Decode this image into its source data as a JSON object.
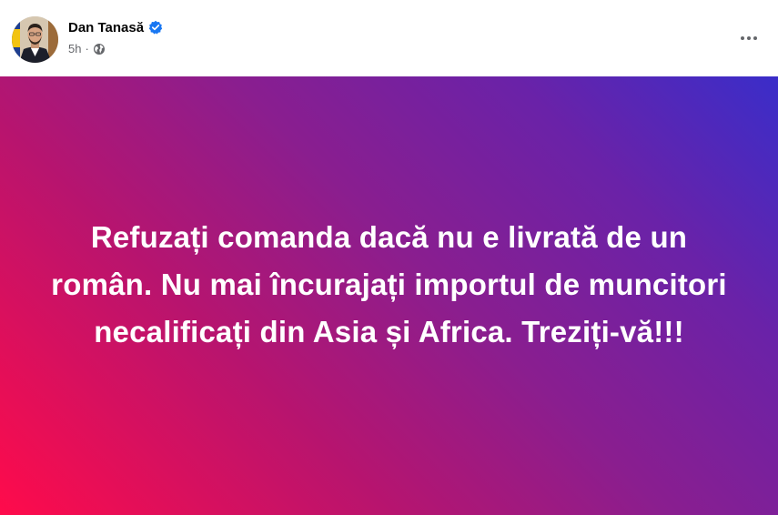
{
  "post": {
    "author_name": "Dan Tanasă",
    "time": "5h",
    "separator": "·",
    "audience_icon": "globe-icon",
    "verified_icon": "verified-badge-icon",
    "more_icon": "more-options-icon",
    "card_text": "Refuzați comanda dacă nu e livrată de un român. Nu mai încurajați importul de muncitori necalificați din Asia și Africa. Treziți-vă!!!"
  },
  "colors": {
    "verified": "#1877f2",
    "gradient_start": "#ff0b4b",
    "gradient_end": "#3a2dc9"
  }
}
